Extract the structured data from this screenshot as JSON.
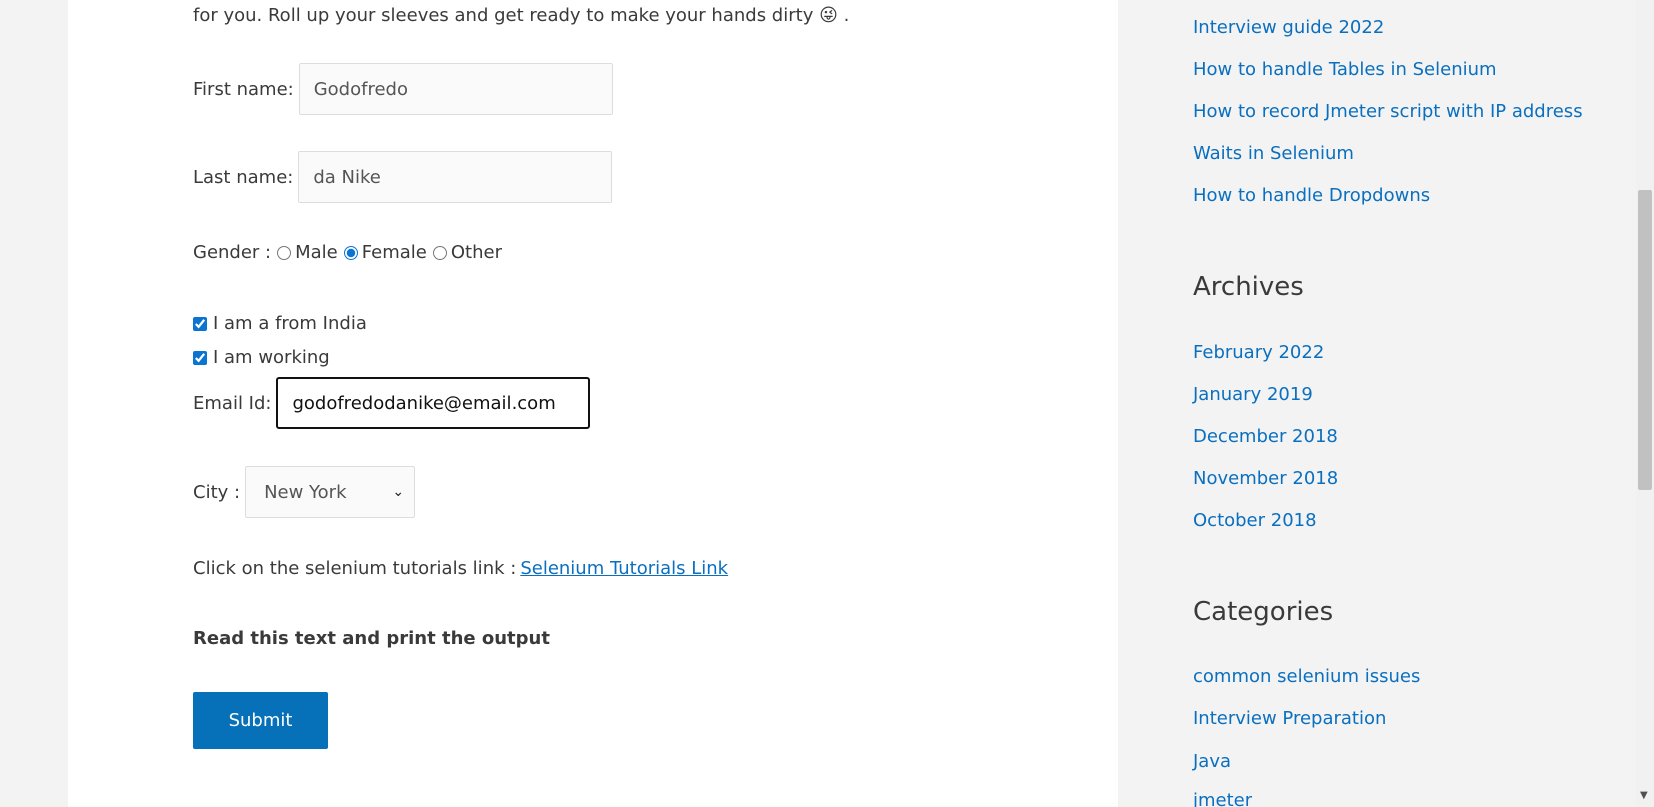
{
  "intro": {
    "text": "for you. Roll up your sleeves and get ready to make your hands dirty",
    "emoji": "😜",
    "tail": "."
  },
  "form": {
    "first_name_label": "First name:",
    "first_name_value": "Godofredo",
    "last_name_label": "Last name:",
    "last_name_value": "da Nike",
    "gender_label": "Gender :",
    "gender_options": [
      "Male",
      "Female",
      "Other"
    ],
    "gender_selected": "Female",
    "check_india_label": "I am a from India",
    "check_working_label": "I am working",
    "email_label": "Email Id:",
    "email_value": "godofredodanike@email.com",
    "city_label": "City :",
    "city_value": "New York",
    "link_prompt": "Click on the selenium tutorials link :",
    "link_text": "Selenium Tutorials Link",
    "read_text": "Read this text and print the output",
    "submit_label": "Submit"
  },
  "sidebar": {
    "recent_links": [
      "Interview guide 2022",
      "How to handle Tables in Selenium",
      "How to record Jmeter script with IP address",
      "Waits in Selenium",
      "How to handle Dropdowns"
    ],
    "archives_heading": "Archives",
    "archives": [
      "February 2022",
      "January 2019",
      "December 2018",
      "November 2018",
      "October 2018"
    ],
    "categories_heading": "Categories",
    "categories": [
      "common selenium issues",
      "Interview Preparation",
      "Java",
      "jmeter"
    ]
  },
  "colors": {
    "link": "#0a6fbf",
    "button": "#0670b8",
    "background": "#f3f3f3"
  }
}
